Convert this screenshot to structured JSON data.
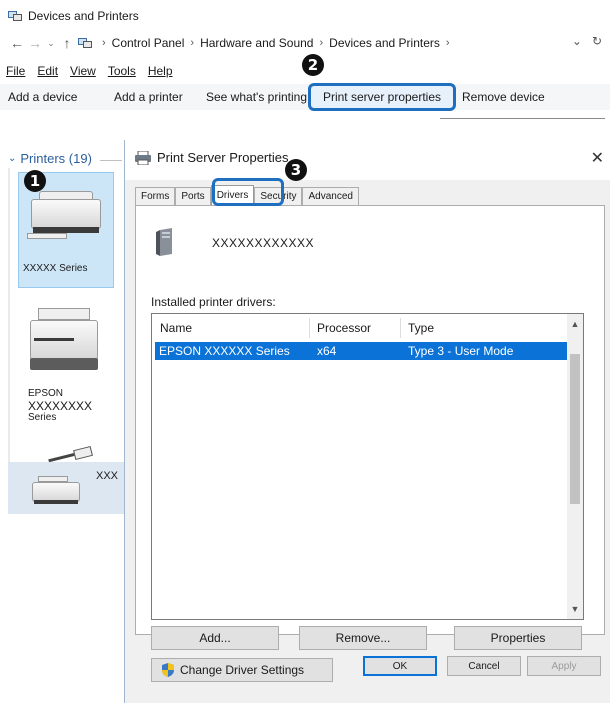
{
  "explorer": {
    "window_title": "Devices and Printers",
    "breadcrumb": [
      "Control Panel",
      "Hardware and Sound",
      "Devices and Printers"
    ],
    "menu": [
      "File",
      "Edit",
      "View",
      "Tools",
      "Help"
    ],
    "commands": {
      "add_device": "Add a device",
      "add_printer": "Add a printer",
      "see_printing": "See what's printing",
      "print_server": "Print server properties",
      "remove_device": "Remove device"
    }
  },
  "steps": {
    "one": "1",
    "two": "2",
    "three": "3"
  },
  "printers_pane": {
    "header": "Printers (19)",
    "tiles": [
      {
        "label": "XXXXX Series"
      },
      {
        "label_lines": [
          "EPSON",
          "XXXXXXXX",
          "Series"
        ]
      },
      {
        "label": "XXX"
      }
    ]
  },
  "dialog": {
    "title": "Print Server Properties",
    "close": "✕",
    "tabs": [
      "Forms",
      "Ports",
      "Drivers",
      "Security",
      "Advanced"
    ],
    "server_name": "XXXXXXXXXXXX",
    "installed_label": "Installed printer drivers:",
    "columns": [
      "Name",
      "Processor",
      "Type"
    ],
    "rows": [
      {
        "name": "EPSON XXXXXX Series",
        "processor": "x64",
        "type": "Type 3 - User Mode"
      }
    ],
    "buttons": {
      "add": "Add...",
      "remove": "Remove...",
      "properties": "Properties",
      "change_driver": "Change Driver Settings",
      "ok": "OK",
      "cancel": "Cancel",
      "apply": "Apply"
    }
  },
  "colors": {
    "accent": "#1f6fc1",
    "selection": "#0b73d8",
    "tile_selected": "#cde6f7"
  }
}
